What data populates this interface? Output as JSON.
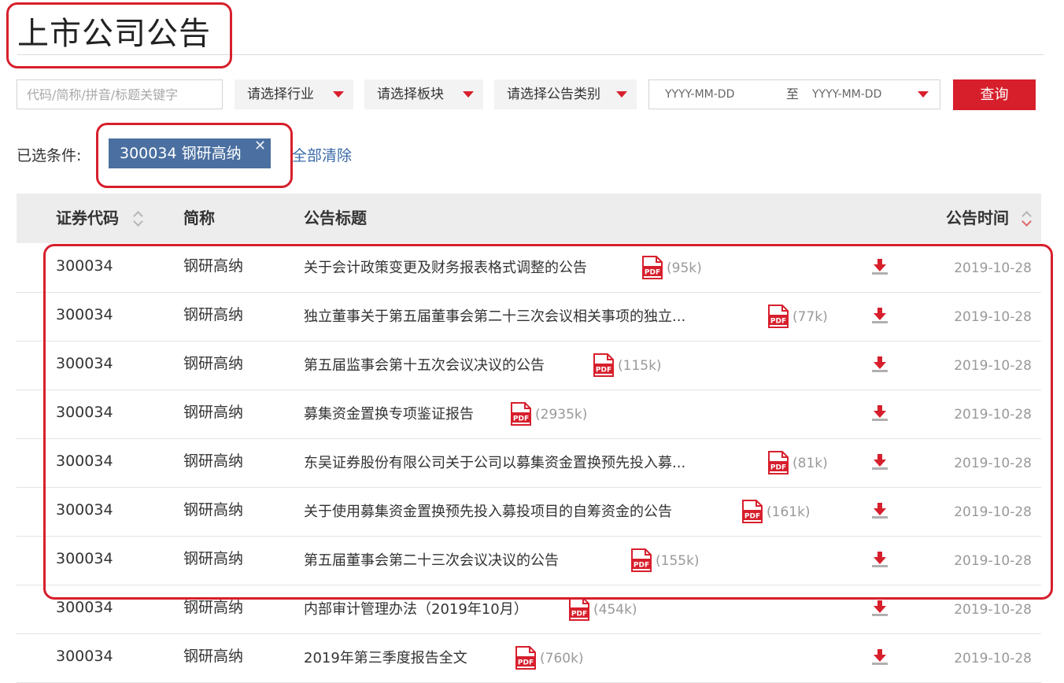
{
  "page": {
    "title": "上市公司公告"
  },
  "filters": {
    "keyword_placeholder": "代码/简称/拼音/标题关键字",
    "industry": "请选择行业",
    "board": "请选择板块",
    "category": "请选择公告类别",
    "date_from": "YYYY-MM-DD",
    "date_sep": "至",
    "date_to": "YYYY-MM-DD",
    "query_label": "查询"
  },
  "selected": {
    "label": "已选条件:",
    "chip": "300034 钢研高纳",
    "clear_all": "全部清除"
  },
  "table": {
    "headers": {
      "code": "证券代码",
      "name": "简称",
      "title": "公告标题",
      "time": "公告时间"
    },
    "rows": [
      {
        "code": "300034",
        "name": "钢研高纳",
        "title": "关于会计政策变更及财务报表格式调整的公告",
        "size": "(95k)",
        "date": "2019-10-28"
      },
      {
        "code": "300034",
        "name": "钢研高纳",
        "title": "独立董事关于第五届董事会第二十三次会议相关事项的独立...",
        "size": "(77k)",
        "date": "2019-10-28"
      },
      {
        "code": "300034",
        "name": "钢研高纳",
        "title": "第五届监事会第十五次会议决议的公告",
        "size": "(115k)",
        "date": "2019-10-28"
      },
      {
        "code": "300034",
        "name": "钢研高纳",
        "title": "募集资金置换专项鉴证报告",
        "size": "(2935k)",
        "date": "2019-10-28"
      },
      {
        "code": "300034",
        "name": "钢研高纳",
        "title": "东吴证券股份有限公司关于公司以募集资金置换预先投入募...",
        "size": "(81k)",
        "date": "2019-10-28"
      },
      {
        "code": "300034",
        "name": "钢研高纳",
        "title": "关于使用募集资金置换预先投入募投项目的自筹资金的公告",
        "size": "(161k)",
        "date": "2019-10-28"
      },
      {
        "code": "300034",
        "name": "钢研高纳",
        "title": "第五届董事会第二十三次会议决议的公告",
        "size": "(155k)",
        "date": "2019-10-28"
      },
      {
        "code": "300034",
        "name": "钢研高纳",
        "title": "内部审计管理办法（2019年10月）",
        "size": "(454k)",
        "date": "2019-10-28"
      },
      {
        "code": "300034",
        "name": "钢研高纳",
        "title": "2019年第三季度报告全文",
        "size": "(760k)",
        "date": "2019-10-28"
      }
    ]
  },
  "icons": {
    "pdf": "pdf-icon",
    "download": "download-icon",
    "sort": "sort-arrows-icon",
    "close": "close-icon",
    "dropdown": "dropdown-triangle-icon"
  },
  "colors": {
    "accent": "#d71f2c",
    "chip": "#4a6fa0",
    "link": "#3a6aa8",
    "header_bg": "#ededed"
  }
}
